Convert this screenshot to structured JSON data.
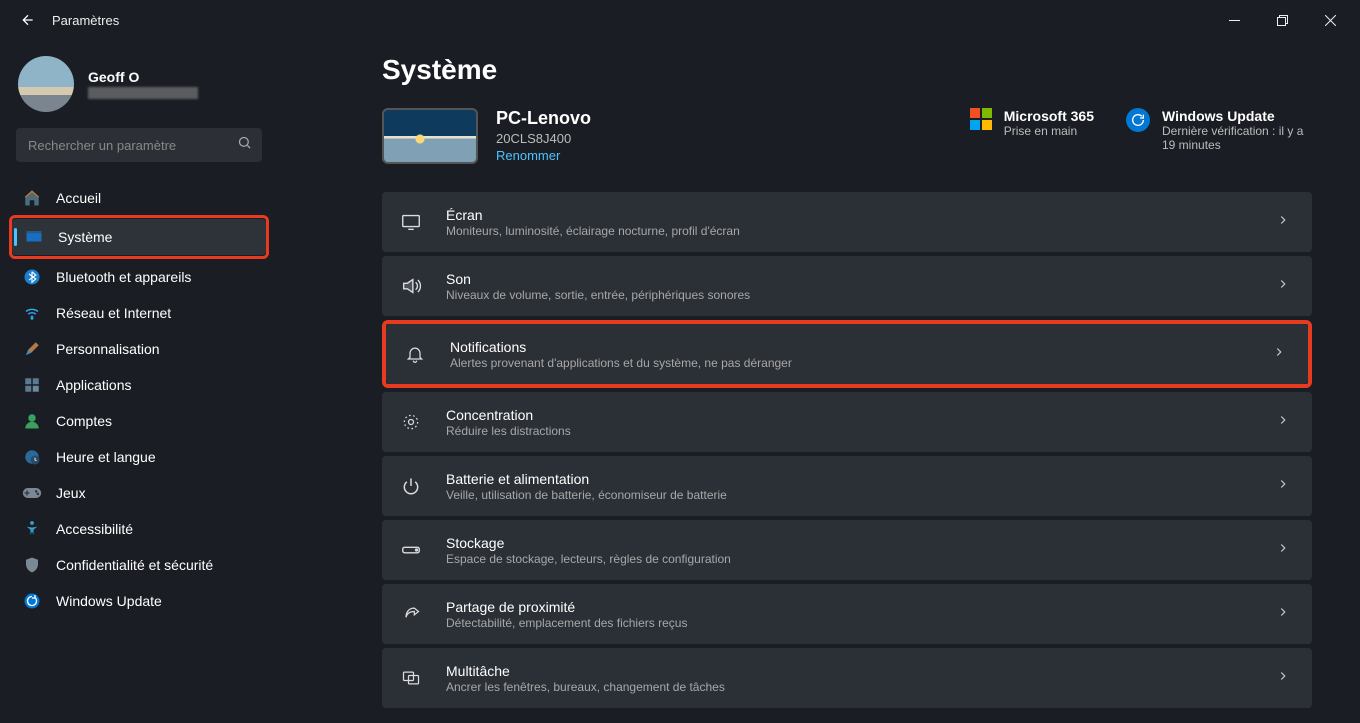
{
  "titlebar": {
    "title": "Paramètres"
  },
  "profile": {
    "name": "Geoff O"
  },
  "search": {
    "placeholder": "Rechercher un paramètre"
  },
  "sidebar": {
    "items": [
      {
        "label": "Accueil"
      },
      {
        "label": "Système"
      },
      {
        "label": "Bluetooth et appareils"
      },
      {
        "label": "Réseau et Internet"
      },
      {
        "label": "Personnalisation"
      },
      {
        "label": "Applications"
      },
      {
        "label": "Comptes"
      },
      {
        "label": "Heure et langue"
      },
      {
        "label": "Jeux"
      },
      {
        "label": "Accessibilité"
      },
      {
        "label": "Confidentialité et sécurité"
      },
      {
        "label": "Windows Update"
      }
    ]
  },
  "main": {
    "page_title": "Système",
    "pc": {
      "name": "PC-Lenovo",
      "model": "20CLS8J400",
      "rename": "Renommer"
    },
    "ms365": {
      "title": "Microsoft 365",
      "sub": "Prise en main"
    },
    "wu": {
      "title": "Windows Update",
      "sub": "Dernière vérification : il y a 19 minutes"
    },
    "settings": [
      {
        "title": "Écran",
        "desc": "Moniteurs, luminosité, éclairage nocturne, profil d'écran"
      },
      {
        "title": "Son",
        "desc": "Niveaux de volume, sortie, entrée, périphériques sonores"
      },
      {
        "title": "Notifications",
        "desc": "Alertes provenant d'applications et du système, ne pas déranger"
      },
      {
        "title": "Concentration",
        "desc": "Réduire les distractions"
      },
      {
        "title": "Batterie et alimentation",
        "desc": "Veille, utilisation de batterie, économiseur de batterie"
      },
      {
        "title": "Stockage",
        "desc": "Espace de stockage, lecteurs, règles de configuration"
      },
      {
        "title": "Partage de proximité",
        "desc": "Détectabilité, emplacement des fichiers reçus"
      },
      {
        "title": "Multitâche",
        "desc": "Ancrer les fenêtres, bureaux, changement de tâches"
      }
    ]
  }
}
